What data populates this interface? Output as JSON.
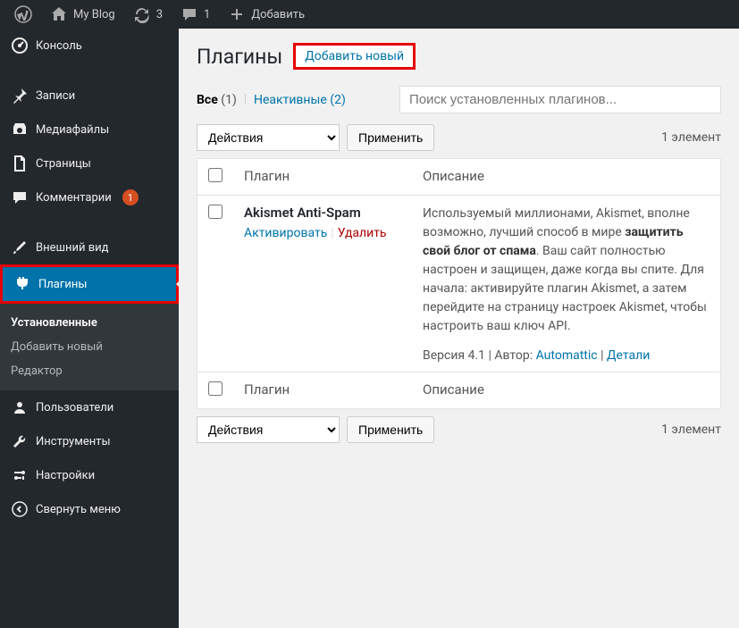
{
  "topbar": {
    "site_name": "My Blog",
    "updates_count": "3",
    "comments_count": "1",
    "add_label": "Добавить"
  },
  "sidebar": {
    "items": [
      {
        "label": "Консоль"
      },
      {
        "label": "Записи"
      },
      {
        "label": "Медиафайлы"
      },
      {
        "label": "Страницы"
      },
      {
        "label": "Комментарии",
        "badge": "1"
      },
      {
        "label": "Внешний вид"
      },
      {
        "label": "Плагины"
      },
      {
        "label": "Пользователи"
      },
      {
        "label": "Инструменты"
      },
      {
        "label": "Настройки"
      },
      {
        "label": "Свернуть меню"
      }
    ],
    "submenu": [
      {
        "label": "Установленные"
      },
      {
        "label": "Добавить новый"
      },
      {
        "label": "Редактор"
      }
    ]
  },
  "page": {
    "title": "Плагины",
    "add_new": "Добавить новый"
  },
  "filters": {
    "all_label": "Все",
    "all_count": "(1)",
    "inactive_label": "Неактивные",
    "inactive_count": "(2)"
  },
  "search": {
    "placeholder": "Поиск установленных плагинов..."
  },
  "bulk": {
    "action_label": "Действия",
    "apply_label": "Применить",
    "count_text": "1 элемент"
  },
  "table": {
    "col_plugin": "Плагин",
    "col_desc": "Описание"
  },
  "plugin": {
    "name": "Akismet Anti-Spam",
    "activate": "Активировать",
    "delete": "Удалить",
    "desc_1": "Используемый миллионами, Akismet, вполне возможно, лучший способ в мире ",
    "desc_bold": "защитить свой блог от спама",
    "desc_2": ". Ваш сайт полностью настроен и защищен, даже когда вы спите. Для начала: активируйте плагин Akismet, а затем перейдите на страницу настроек Akismet, чтобы настроить ваш ключ API.",
    "version_label": "Версия 4.1",
    "author_label": "Автор:",
    "author_name": "Automattic",
    "details": "Детали"
  }
}
